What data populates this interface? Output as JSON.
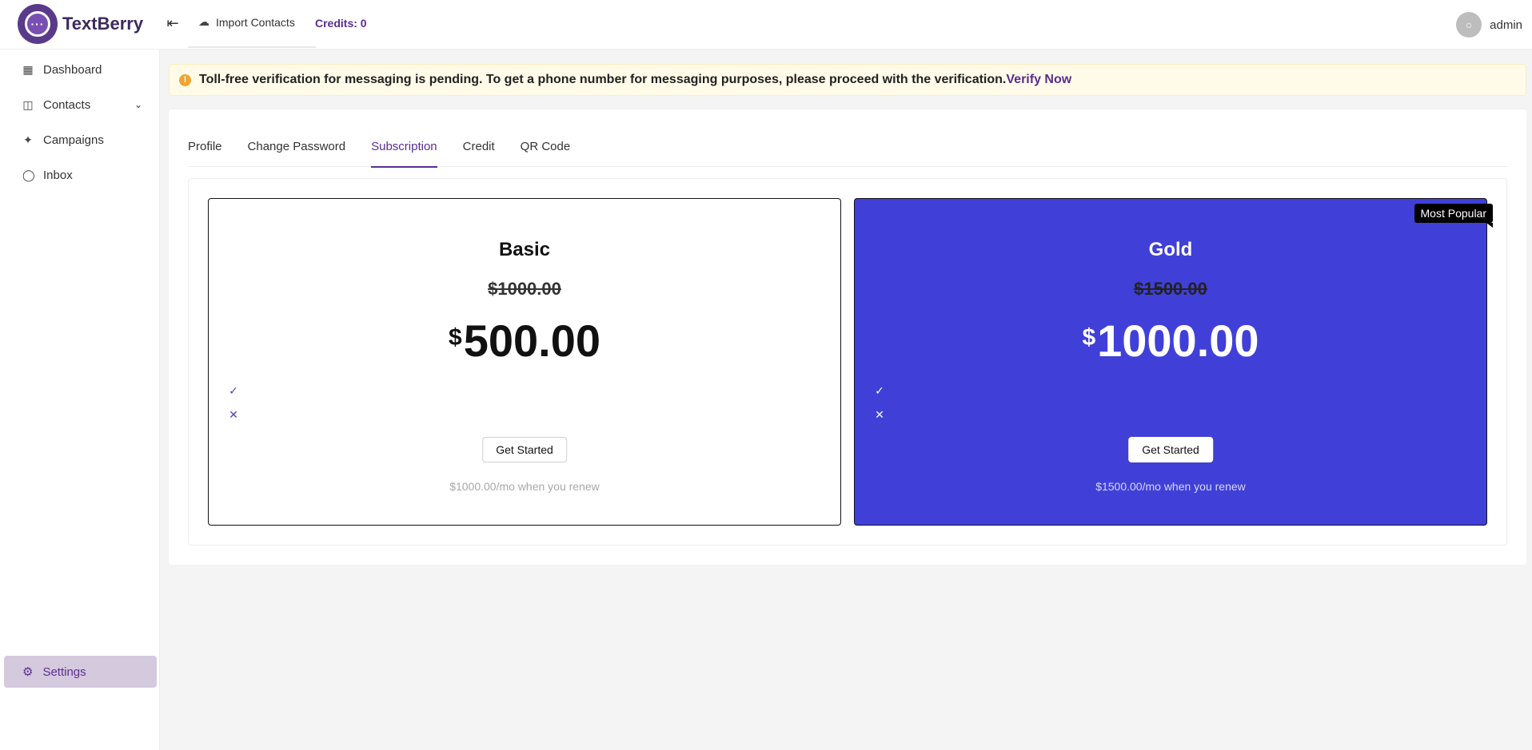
{
  "brand": {
    "name": "TextBerry",
    "logo_glyph": "···"
  },
  "header": {
    "menu_icon": "menu-collapse-icon",
    "import_label": "Import Contacts",
    "credits_label": "Credits: 0",
    "user_name": "admin"
  },
  "sidebar": {
    "items": [
      {
        "label": "Dashboard",
        "icon": "grid-icon"
      },
      {
        "label": "Contacts",
        "icon": "contacts-icon"
      },
      {
        "label": "Campaigns",
        "icon": "megaphone-icon"
      },
      {
        "label": "Inbox",
        "icon": "chat-icon"
      }
    ],
    "settings_label": "Settings"
  },
  "alert": {
    "message": "Toll-free verification for messaging is pending. To get a phone number for messaging purposes, please proceed with the verification.",
    "link": "Verify Now"
  },
  "tabs": [
    "Profile",
    "Change Password",
    "Subscription",
    "Credit",
    "QR Code"
  ],
  "active_tab": "Subscription",
  "plans": [
    {
      "name": "Basic",
      "old_price": "$1000.00",
      "currency": "$",
      "price": "500.00",
      "button": "Get Started",
      "renew": "$1000.00/mo when you renew"
    },
    {
      "name": "Gold",
      "old_price": "$1500.00",
      "currency": "$",
      "price": "1000.00",
      "button": "Get Started",
      "renew": "$1500.00/mo when you renew",
      "badge": "Most Popular"
    }
  ],
  "colors": {
    "brand_purple": "#5a2d91",
    "gold_plan_bg": "#4040d9",
    "alert_bg": "#fffbe8",
    "settings_active_bg": "#d5c9de"
  }
}
